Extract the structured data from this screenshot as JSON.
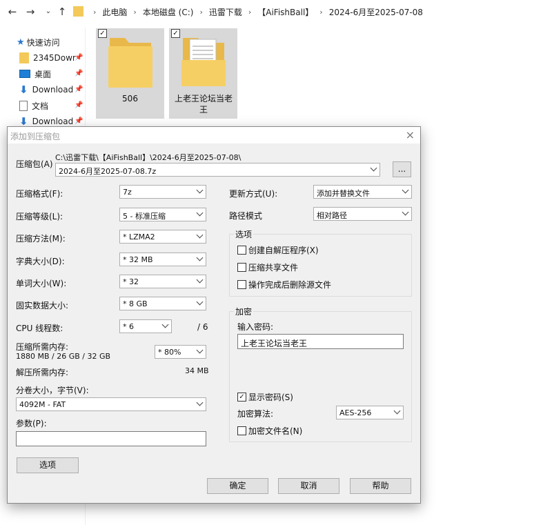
{
  "explorer": {
    "breadcrumbs": [
      "此电脑",
      "本地磁盘 (C:)",
      "迅雷下载",
      "【AiFishBall】",
      "2024-6月至2025-07-08"
    ],
    "sidebar": [
      {
        "label": "快速访问",
        "icon": "star-icon"
      },
      {
        "label": "2345Dowr",
        "icon": "folder-icon"
      },
      {
        "label": "桌面",
        "icon": "desktop-icon"
      },
      {
        "label": "Download",
        "icon": "download-arrow-icon"
      },
      {
        "label": "文档",
        "icon": "document-icon"
      },
      {
        "label": "Download",
        "icon": "download-arrow-icon"
      }
    ],
    "files": [
      {
        "name": "506",
        "checked": true
      },
      {
        "name": "上老王论坛当老王",
        "checked": true
      }
    ]
  },
  "dialog": {
    "title": "添加到压缩包",
    "close": "×",
    "archive_label": "压缩包(A)",
    "archive_path": "C:\\迅雷下载\\【AiFishBall】\\2024-6月至2025-07-08\\",
    "archive_name": "2024-6月至2025-07-08.7z",
    "browse_label": "...",
    "format_label": "压缩格式(F):",
    "format_value": "7z",
    "level_label": "压缩等级(L):",
    "level_value": "5 - 标准压缩",
    "method_label": "压缩方法(M):",
    "method_value": "* LZMA2",
    "dict_label": "字典大小(D):",
    "dict_value": "* 32 MB",
    "word_label": "单词大小(W):",
    "word_value": "* 32",
    "solid_label": "固实数据大小:",
    "solid_value": "* 8 GB",
    "cpu_label": "CPU 线程数:",
    "cpu_value": "* 6",
    "cpu_total": "/ 6",
    "mem_label": "压缩所需内存:",
    "mem_detail": "1880 MB / 26 GB / 32 GB",
    "mem_percent": "* 80%",
    "decomp_label": "解压所需内存:",
    "decomp_value": "34 MB",
    "split_label": "分卷大小，字节(V):",
    "split_value": "4092M - FAT",
    "params_label": "参数(P):",
    "params_value": "",
    "options_button": "选项",
    "update_label": "更新方式(U):",
    "update_value": "添加并替换文件",
    "path_mode_label": "路径模式",
    "path_mode_value": "相对路径",
    "options_group": "选项",
    "opt_sfx": "创建自解压程序(X)",
    "opt_shared": "压缩共享文件",
    "opt_delete": "操作完成后删除源文件",
    "encrypt_group": "加密",
    "password_label": "输入密码:",
    "password_value": "上老王论坛当老王",
    "show_password": "显示密码(S)",
    "encrypt_method_label": "加密算法:",
    "encrypt_method_value": "AES-256",
    "encrypt_names": "加密文件名(N)",
    "ok": "确定",
    "cancel": "取消",
    "help": "帮助",
    "check_mark": "✓"
  }
}
